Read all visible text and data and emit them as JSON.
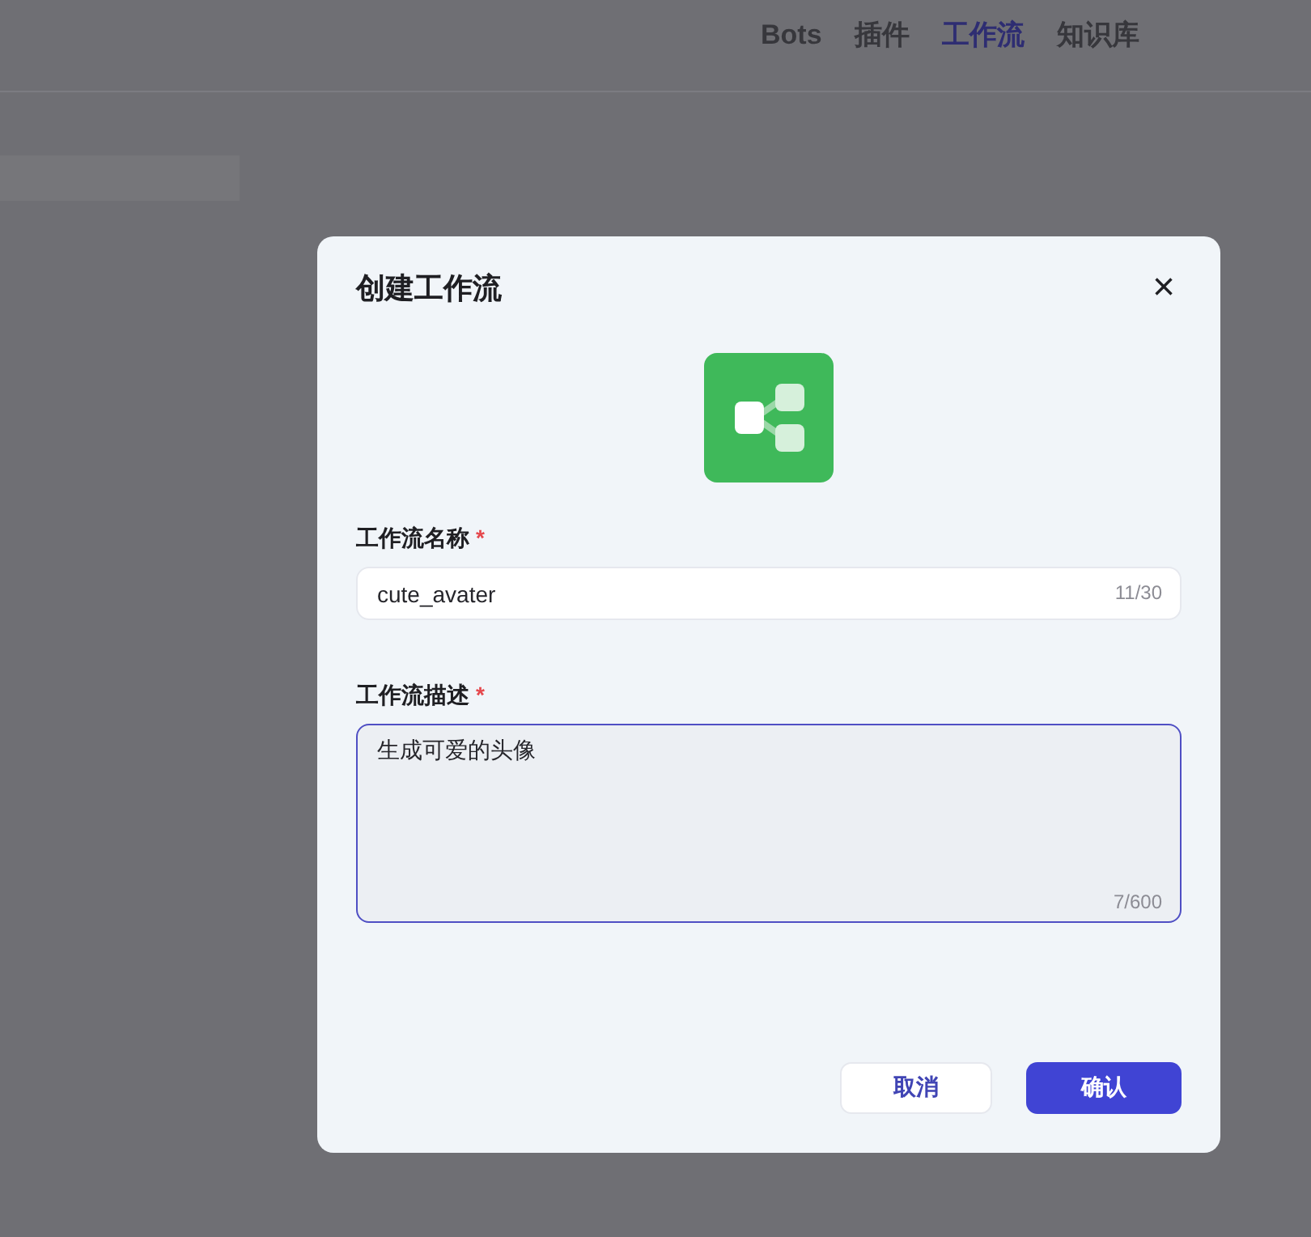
{
  "nav": [
    {
      "label": "Bots",
      "selected": false
    },
    {
      "label": "插件",
      "selected": false
    },
    {
      "label": "工作流",
      "selected": true
    },
    {
      "label": "知识库",
      "selected": false
    }
  ],
  "dialog": {
    "title": "创建工作流",
    "close": "×",
    "name_field": {
      "label": "工作流名称",
      "required_mark": "*",
      "value": "cute_avater",
      "count": "11/30",
      "focused": false
    },
    "description_field": {
      "label": "工作流描述",
      "required_mark": "*",
      "value": "生成可爱的头像",
      "count": "7/600",
      "focused": true
    },
    "buttons": [
      {
        "label": "取消",
        "kind": "secondary"
      },
      {
        "label": "确认",
        "kind": "primary"
      }
    ]
  }
}
